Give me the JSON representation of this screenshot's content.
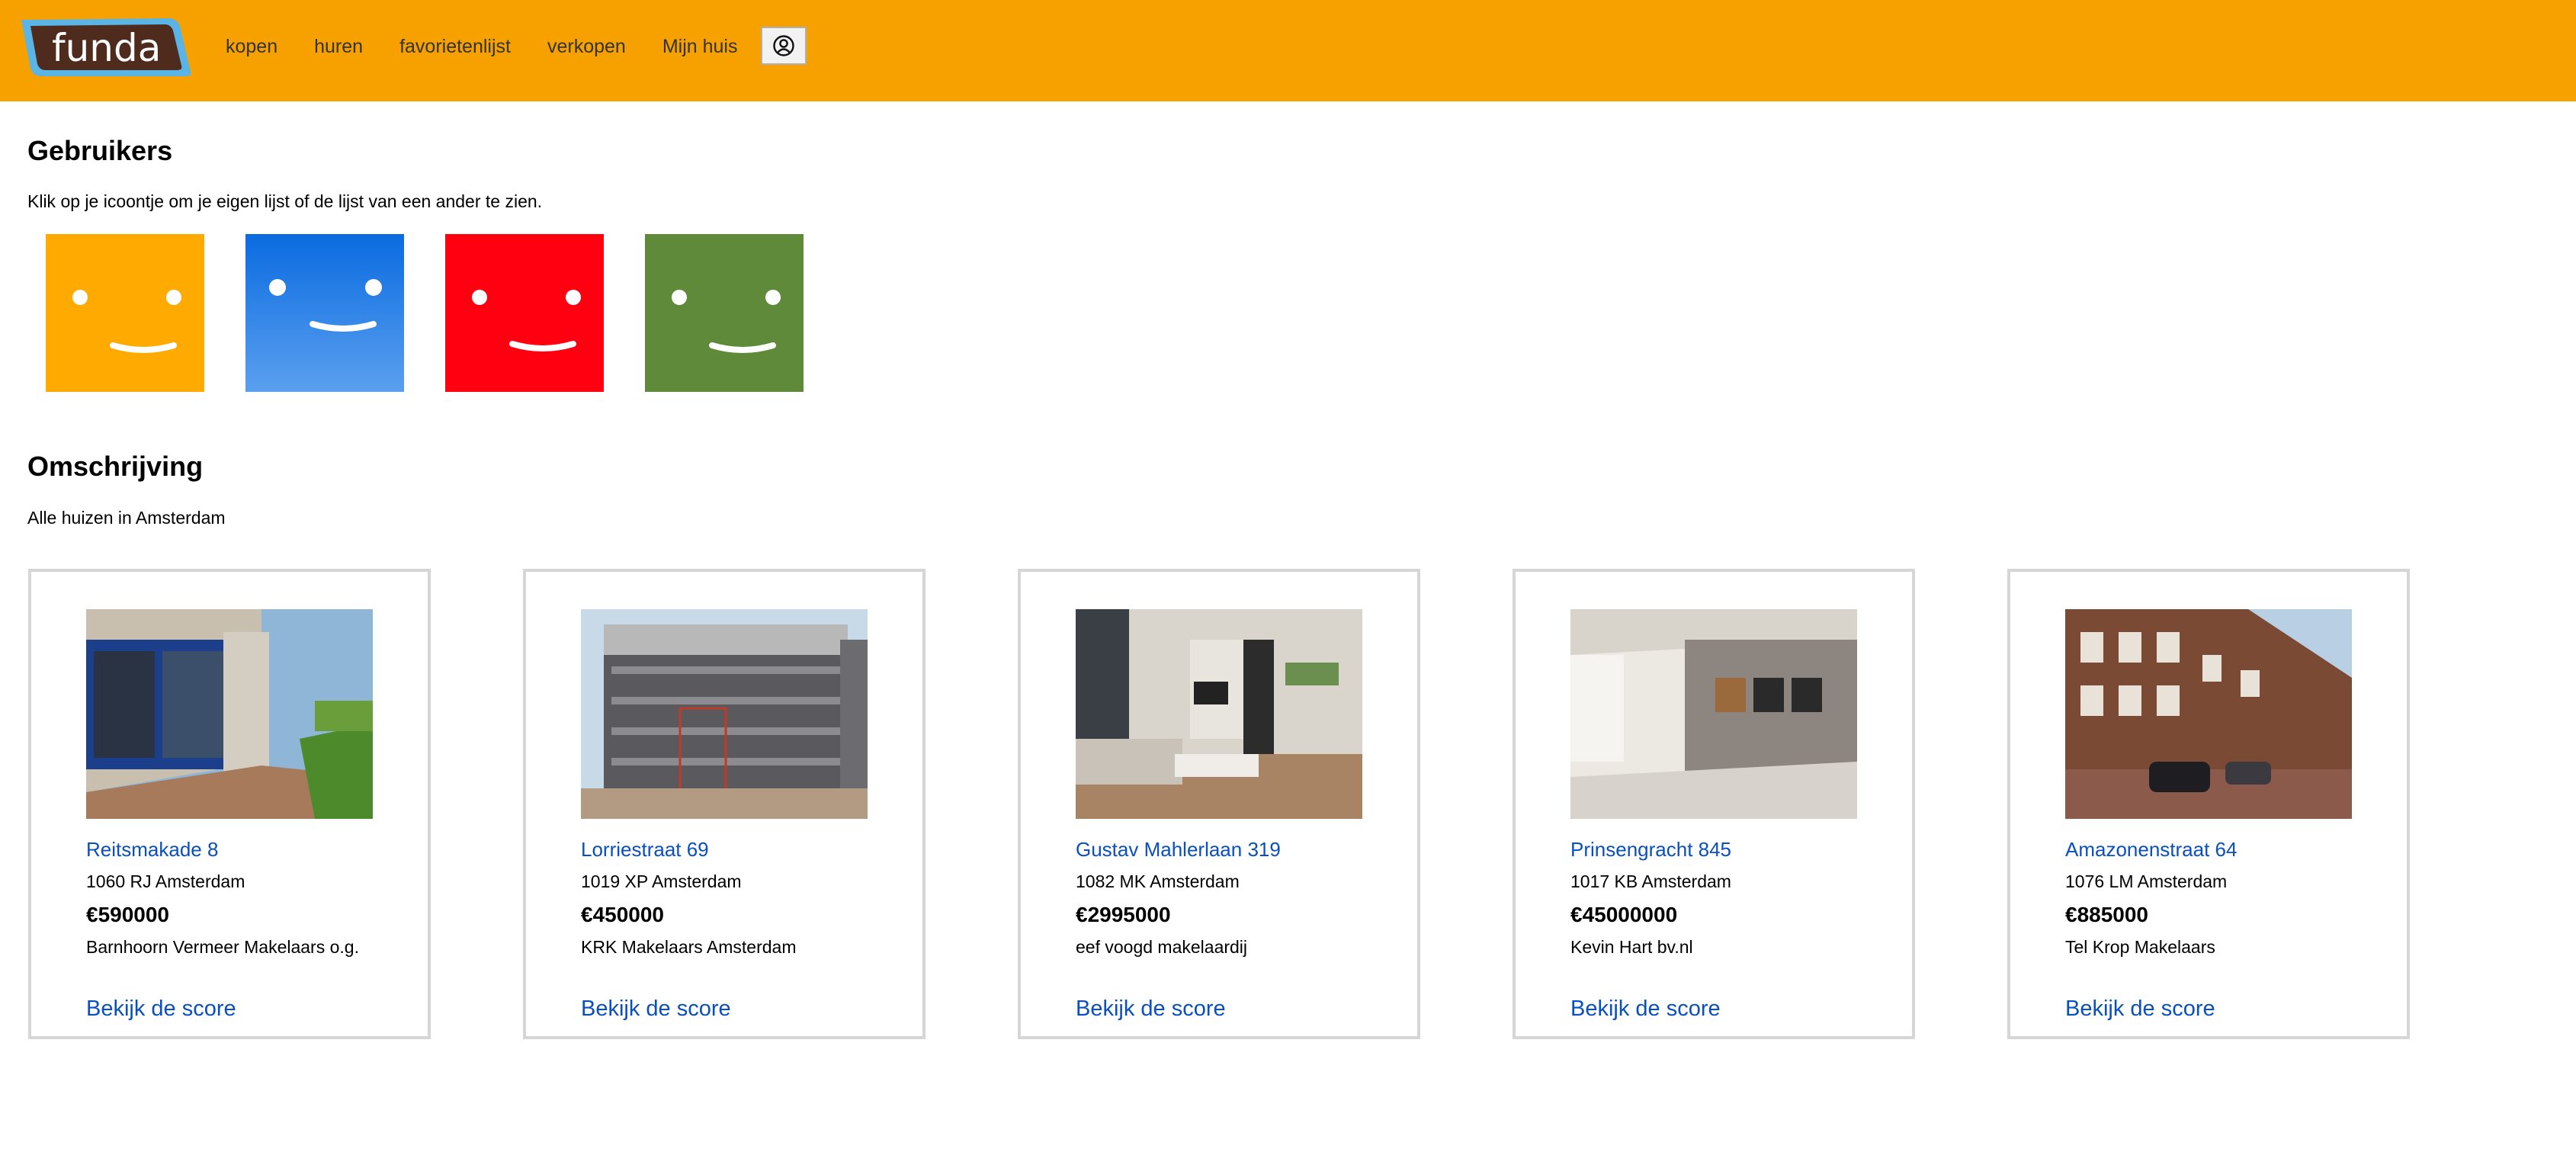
{
  "header": {
    "logo_text": "funda",
    "nav": [
      "kopen",
      "huren",
      "favorietenlijst",
      "verkopen",
      "Mijn huis"
    ],
    "account_icon": "user-circle-icon"
  },
  "users": {
    "title": "Gebruikers",
    "text": "Klik op je icoontje om je eigen lijst of de lijst van een ander te zien.",
    "avatars": [
      {
        "name": "avatar-orange",
        "color": "#ffaa00"
      },
      {
        "name": "avatar-blue",
        "color": "#1672e6"
      },
      {
        "name": "avatar-red",
        "color": "#ff0010"
      },
      {
        "name": "avatar-green",
        "color": "#5e8a3a"
      }
    ]
  },
  "description": {
    "title": "Omschrijving",
    "text": "Alle huizen in Amsterdam"
  },
  "listings": [
    {
      "street": "Reitsmakade 8",
      "city": "1060 RJ Amsterdam",
      "price": "€590000",
      "agent": "Barnhoorn Vermeer Makelaars o.g.",
      "link": "Bekijk de score"
    },
    {
      "street": "Lorriestraat 69",
      "city": "1019 XP Amsterdam",
      "price": "€450000",
      "agent": "KRK Makelaars Amsterdam",
      "link": "Bekijk de score"
    },
    {
      "street": "Gustav Mahlerlaan 319",
      "city": "1082 MK Amsterdam",
      "price": "€2995000",
      "agent": "eef voogd makelaardij",
      "link": "Bekijk de score"
    },
    {
      "street": "Prinsengracht 845",
      "city": "1017 KB Amsterdam",
      "price": "€45000000",
      "agent": "Kevin Hart bv.nl",
      "link": "Bekijk de score"
    },
    {
      "street": "Amazonenstraat 64",
      "city": "1076 LM Amsterdam",
      "price": "€885000",
      "agent": "Tel Krop Makelaars",
      "link": "Bekijk de score"
    }
  ],
  "colors": {
    "header_bg": "#f7a100",
    "logo_bg": "#4f2b1d",
    "logo_border": "#5ab4e6",
    "link": "#0a4fbf"
  }
}
